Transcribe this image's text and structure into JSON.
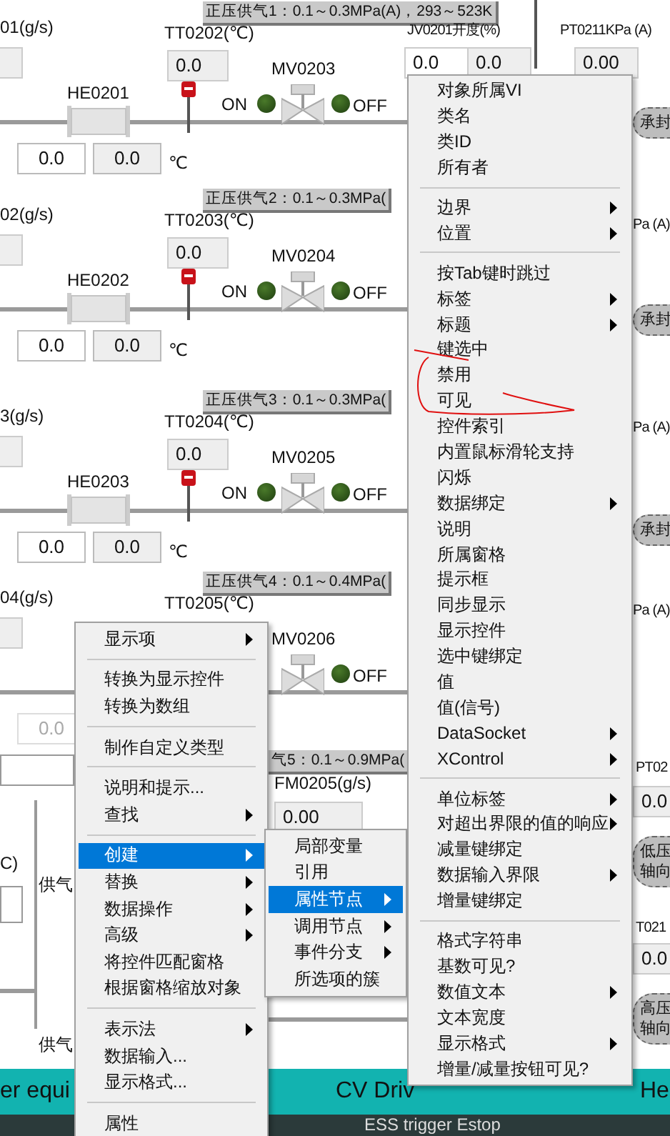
{
  "sections": [
    {
      "title": "正压供气1：0.1～0.3MPa(A)，293～523K",
      "flow_label": "01(g/s)",
      "temp_label": "TT0202(℃)",
      "temp_value": "0.0",
      "valve_label": "MV0203",
      "heater_label": "HE0201",
      "on_label": "ON",
      "off_label": "OFF",
      "readings": [
        "0.0",
        "0.0"
      ],
      "unit": "℃",
      "dimmed": false
    },
    {
      "title": "正压供气2：0.1～0.3MPa(",
      "flow_label": "02(g/s)",
      "temp_label": "TT0203(℃)",
      "temp_value": "0.0",
      "valve_label": "MV0204",
      "heater_label": "HE0202",
      "on_label": "ON",
      "off_label": "OFF",
      "readings": [
        "0.0",
        "0.0"
      ],
      "unit": "℃",
      "dimmed": false
    },
    {
      "title": "正压供气3：0.1～0.3MPa(",
      "flow_label": "3(g/s)",
      "temp_label": "TT0204(℃)",
      "temp_value": "0.0",
      "valve_label": "MV0205",
      "heater_label": "HE0203",
      "on_label": "ON",
      "off_label": "OFF",
      "readings": [
        "0.0",
        "0.0"
      ],
      "unit": "℃",
      "dimmed": false
    },
    {
      "title": "正压供气4：0.1～0.4MPa(",
      "flow_label": "04(g/s)",
      "temp_label": "TT0205(℃)",
      "valve_label": "MV0206",
      "off_label": "OFF",
      "readings": [
        "0.0"
      ],
      "dimmed": true
    }
  ],
  "section_5": {
    "title": "气5：0.1～0.9MPa(",
    "flow_label": "FM0205(g/s)",
    "flow_value": "0.00"
  },
  "left_labels": [
    "C)",
    "供气",
    "供气"
  ],
  "right_column": [
    {
      "kind": "label",
      "text": "JV0201开度(%)"
    },
    {
      "kind": "value",
      "text": "0.0"
    },
    {
      "kind": "value",
      "text": "0.0"
    },
    {
      "kind": "label",
      "text": "PT0211KPa (A)"
    },
    {
      "kind": "value",
      "text": "0.00"
    },
    {
      "kind": "oval",
      "lines": [
        "承封"
      ]
    },
    {
      "kind": "label",
      "text": "Pa (A)"
    },
    {
      "kind": "oval",
      "lines": [
        "承封"
      ]
    },
    {
      "kind": "label",
      "text": "Pa (A)"
    },
    {
      "kind": "oval",
      "lines": [
        "承封"
      ]
    },
    {
      "kind": "label",
      "text": "Pa (A)"
    },
    {
      "kind": "label",
      "text": "PT02"
    },
    {
      "kind": "value",
      "text": "0.0"
    },
    {
      "kind": "oval",
      "lines": [
        "低压",
        "轴向"
      ]
    },
    {
      "kind": "label",
      "text": "T021"
    },
    {
      "kind": "value",
      "text": "0.0"
    },
    {
      "kind": "oval",
      "lines": [
        "高压",
        "轴向"
      ]
    }
  ],
  "status_bar": {
    "labels": [
      "er equi",
      "CV Driv",
      "He"
    ],
    "second_line": "ESS  trigger Estop"
  },
  "menus": [
    {
      "items": [
        {
          "kind": "item",
          "label": "显示项",
          "submenu": true,
          "selected": false
        },
        {
          "kind": "separator"
        },
        {
          "kind": "item",
          "label": "转换为显示控件",
          "submenu": false,
          "selected": false
        },
        {
          "kind": "item",
          "label": "转换为数组",
          "submenu": false,
          "selected": false
        },
        {
          "kind": "separator"
        },
        {
          "kind": "item",
          "label": "制作自定义类型",
          "submenu": false,
          "selected": false
        },
        {
          "kind": "separator"
        },
        {
          "kind": "item",
          "label": "说明和提示...",
          "submenu": false,
          "selected": false
        },
        {
          "kind": "item",
          "label": "查找",
          "submenu": true,
          "selected": false
        },
        {
          "kind": "separator"
        },
        {
          "kind": "item",
          "label": "创建",
          "submenu": true,
          "selected": true
        },
        {
          "kind": "item",
          "label": "替换",
          "submenu": true,
          "selected": false
        },
        {
          "kind": "item",
          "label": "数据操作",
          "submenu": true,
          "selected": false
        },
        {
          "kind": "item",
          "label": "高级",
          "submenu": true,
          "selected": false
        },
        {
          "kind": "item",
          "label": "将控件匹配窗格",
          "submenu": false,
          "selected": false
        },
        {
          "kind": "item",
          "label": "根据窗格缩放对象",
          "submenu": false,
          "selected": false
        },
        {
          "kind": "separator"
        },
        {
          "kind": "item",
          "label": "表示法",
          "submenu": true,
          "selected": false
        },
        {
          "kind": "item",
          "label": "数据输入...",
          "submenu": false,
          "selected": false
        },
        {
          "kind": "item",
          "label": "显示格式...",
          "submenu": false,
          "selected": false
        },
        {
          "kind": "separator"
        },
        {
          "kind": "item",
          "label": "属性",
          "submenu": false,
          "selected": false
        }
      ]
    },
    {
      "items": [
        {
          "kind": "item",
          "label": "局部变量",
          "submenu": false,
          "selected": false
        },
        {
          "kind": "item",
          "label": "引用",
          "submenu": false,
          "selected": false
        },
        {
          "kind": "item",
          "label": "属性节点",
          "submenu": true,
          "selected": true
        },
        {
          "kind": "item",
          "label": "调用节点",
          "submenu": true,
          "selected": false
        },
        {
          "kind": "item",
          "label": "事件分支",
          "submenu": true,
          "selected": false
        },
        {
          "kind": "item",
          "label": "所选项的簇",
          "submenu": false,
          "selected": false
        }
      ]
    },
    {
      "items": [
        {
          "kind": "item",
          "label": "对象所属VI",
          "submenu": false,
          "selected": false
        },
        {
          "kind": "item",
          "label": "类名",
          "submenu": false,
          "selected": false
        },
        {
          "kind": "item",
          "label": "类ID",
          "submenu": false,
          "selected": false
        },
        {
          "kind": "item",
          "label": "所有者",
          "submenu": false,
          "selected": false
        },
        {
          "kind": "separator"
        },
        {
          "kind": "item",
          "label": "边界",
          "submenu": true,
          "selected": false
        },
        {
          "kind": "item",
          "label": "位置",
          "submenu": true,
          "selected": false
        },
        {
          "kind": "separator"
        },
        {
          "kind": "item",
          "label": "按Tab键时跳过",
          "submenu": false,
          "selected": false
        },
        {
          "kind": "item",
          "label": "标签",
          "submenu": true,
          "selected": false
        },
        {
          "kind": "item",
          "label": "标题",
          "submenu": true,
          "selected": false
        },
        {
          "kind": "item",
          "label": "键选中",
          "submenu": false,
          "selected": false
        },
        {
          "kind": "item",
          "label": "禁用",
          "submenu": false,
          "selected": false
        },
        {
          "kind": "item",
          "label": "可见",
          "submenu": false,
          "selected": false
        },
        {
          "kind": "item",
          "label": "控件索引",
          "submenu": false,
          "selected": false
        },
        {
          "kind": "item",
          "label": "内置鼠标滑轮支持",
          "submenu": false,
          "selected": false
        },
        {
          "kind": "item",
          "label": "闪烁",
          "submenu": false,
          "selected": false
        },
        {
          "kind": "item",
          "label": "数据绑定",
          "submenu": true,
          "selected": false
        },
        {
          "kind": "item",
          "label": "说明",
          "submenu": false,
          "selected": false
        },
        {
          "kind": "item",
          "label": "所属窗格",
          "submenu": false,
          "selected": false
        },
        {
          "kind": "item",
          "label": "提示框",
          "submenu": false,
          "selected": false
        },
        {
          "kind": "item",
          "label": "同步显示",
          "submenu": false,
          "selected": false
        },
        {
          "kind": "item",
          "label": "显示控件",
          "submenu": false,
          "selected": false
        },
        {
          "kind": "item",
          "label": "选中键绑定",
          "submenu": false,
          "selected": false
        },
        {
          "kind": "item",
          "label": "值",
          "submenu": false,
          "selected": false
        },
        {
          "kind": "item",
          "label": "值(信号)",
          "submenu": false,
          "selected": false
        },
        {
          "kind": "item",
          "label": "DataSocket",
          "submenu": true,
          "selected": false
        },
        {
          "kind": "item",
          "label": "XControl",
          "submenu": true,
          "selected": false
        },
        {
          "kind": "separator"
        },
        {
          "kind": "item",
          "label": "单位标签",
          "submenu": true,
          "selected": false
        },
        {
          "kind": "item",
          "label": "对超出界限的值的响应",
          "submenu": true,
          "selected": false
        },
        {
          "kind": "item",
          "label": "减量键绑定",
          "submenu": false,
          "selected": false
        },
        {
          "kind": "item",
          "label": "数据输入界限",
          "submenu": true,
          "selected": false
        },
        {
          "kind": "item",
          "label": "增量键绑定",
          "submenu": false,
          "selected": false
        },
        {
          "kind": "separator"
        },
        {
          "kind": "item",
          "label": "格式字符串",
          "submenu": false,
          "selected": false
        },
        {
          "kind": "item",
          "label": "基数可见?",
          "submenu": false,
          "selected": false
        },
        {
          "kind": "item",
          "label": "数值文本",
          "submenu": true,
          "selected": false
        },
        {
          "kind": "item",
          "label": "文本宽度",
          "submenu": false,
          "selected": false
        },
        {
          "kind": "item",
          "label": "显示格式",
          "submenu": true,
          "selected": false
        },
        {
          "kind": "item",
          "label": "增量/减量按钮可见?",
          "submenu": false,
          "selected": false
        }
      ]
    }
  ]
}
